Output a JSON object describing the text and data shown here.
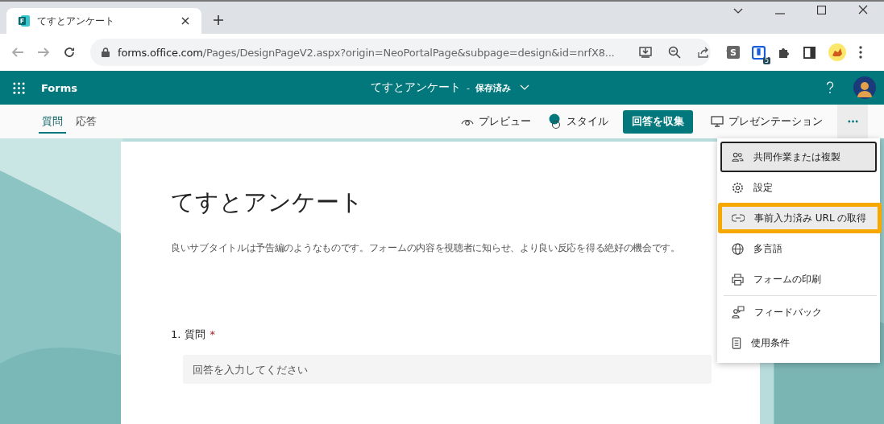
{
  "browser": {
    "tab_title": "てすとアンケート",
    "url_host": "forms.office.com",
    "url_path": "/Pages/DesignPageV2.aspx?origin=NeoPortalPage&subpage=design&id=nrfX8...",
    "extension_letter": "S",
    "extension_badge": "5"
  },
  "app": {
    "name": "Forms",
    "form_title": "てすとアンケート",
    "separator": "-",
    "save_state": "保存済み"
  },
  "tabs": [
    {
      "label": "質問",
      "selected": true
    },
    {
      "label": "応答",
      "selected": false
    }
  ],
  "commands": [
    {
      "kind": "preview",
      "label": "プレビュー"
    },
    {
      "kind": "style",
      "label": "スタイル"
    },
    {
      "kind": "primary",
      "label": "回答を収集"
    },
    {
      "kind": "present",
      "label": "プレゼンテーション"
    }
  ],
  "menu": [
    {
      "kind": "people",
      "label": "共同作業または複製",
      "focused": true,
      "highlighted": false,
      "divider_before": false
    },
    {
      "kind": "gear",
      "label": "設定",
      "focused": false,
      "highlighted": false,
      "divider_before": false
    },
    {
      "kind": "link",
      "label": "事前入力済み URL の取得",
      "focused": false,
      "highlighted": true,
      "divider_before": false
    },
    {
      "kind": "globe",
      "label": "多言語",
      "focused": false,
      "highlighted": false,
      "divider_before": false
    },
    {
      "kind": "print",
      "label": "フォームの印刷",
      "focused": false,
      "highlighted": false,
      "divider_before": false
    },
    {
      "kind": "feedback",
      "label": "フィードバック",
      "focused": false,
      "highlighted": false,
      "divider_before": true
    },
    {
      "kind": "doc",
      "label": "使用条件",
      "focused": false,
      "highlighted": false,
      "divider_before": false
    }
  ],
  "form": {
    "title": "てすとアンケート",
    "subtitle": "良いサブタイトルは予告編のようなものです。フォームの内容を視聴者に知らせ、より良い反応を得る絶好の機会です。",
    "questions": [
      {
        "number": "1.",
        "text": "質問",
        "required": true,
        "required_mark": "*",
        "placeholder": "回答を入力してください"
      }
    ]
  }
}
